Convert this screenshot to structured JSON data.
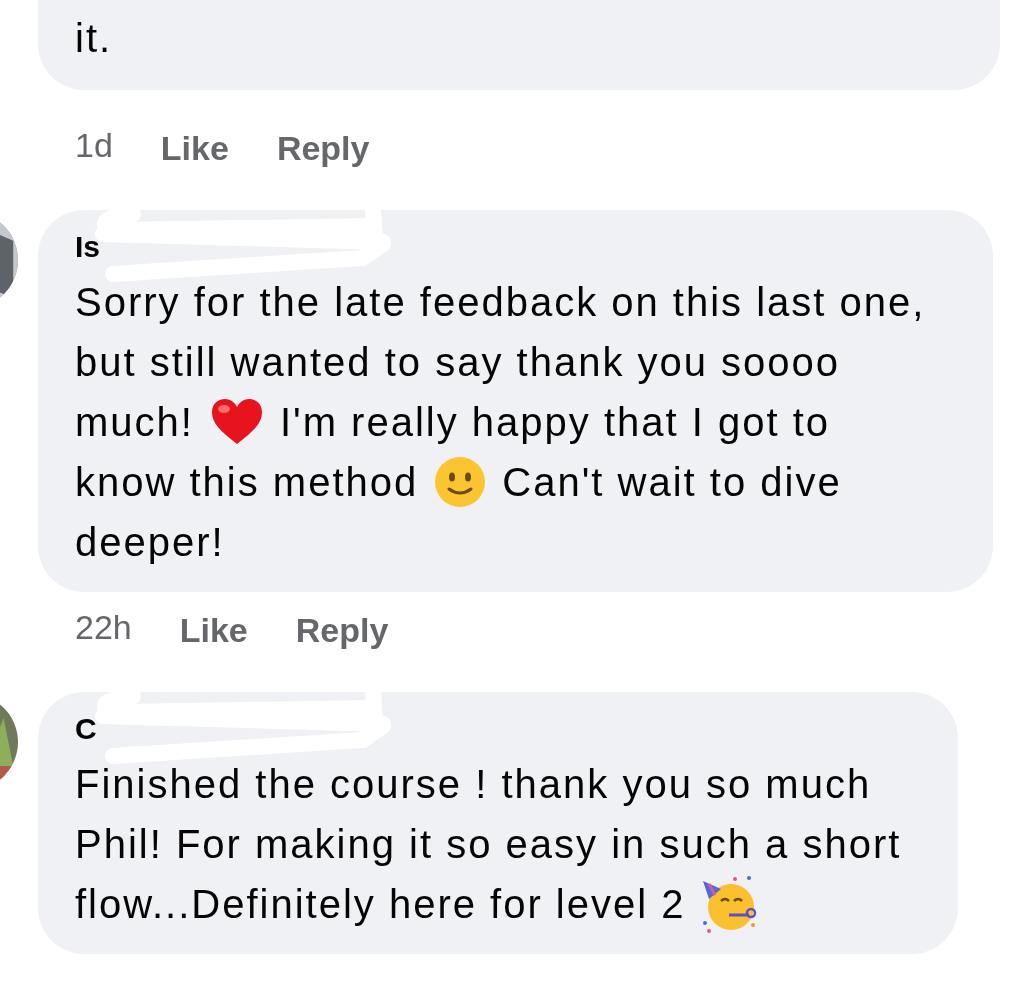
{
  "comments": [
    {
      "avatar": false,
      "lines": [
        [
          {
            "kind": "text",
            "text": "it."
          }
        ]
      ],
      "time": "1d",
      "actions": [
        "Like",
        "Reply"
      ]
    },
    {
      "author": "Is",
      "avatar": true,
      "lines": [
        [
          {
            "kind": "text",
            "text": "Sorry for the late feedback on this last one,"
          }
        ],
        [
          {
            "kind": "text",
            "text": "but still wanted to say thank you soooo"
          }
        ],
        [
          {
            "kind": "text",
            "text": "much!"
          },
          {
            "kind": "heart"
          },
          {
            "kind": "text",
            "text": "I'm really happy that I got to"
          }
        ],
        [
          {
            "kind": "text",
            "text": "know this method"
          },
          {
            "kind": "smiley"
          },
          {
            "kind": "text",
            "text": "Can't wait to dive"
          }
        ],
        [
          {
            "kind": "text",
            "text": "deeper!"
          }
        ]
      ],
      "time": "22h",
      "actions": [
        "Like",
        "Reply"
      ]
    },
    {
      "author": "C",
      "avatar": true,
      "lines": [
        [
          {
            "kind": "text",
            "text": "Finished the course ! thank you so much"
          }
        ],
        [
          {
            "kind": "text",
            "text": "Phil! For making it so easy in such a short"
          }
        ],
        [
          {
            "kind": "text",
            "text": "flow...Definitely here for level 2"
          },
          {
            "kind": "party"
          }
        ]
      ]
    }
  ]
}
